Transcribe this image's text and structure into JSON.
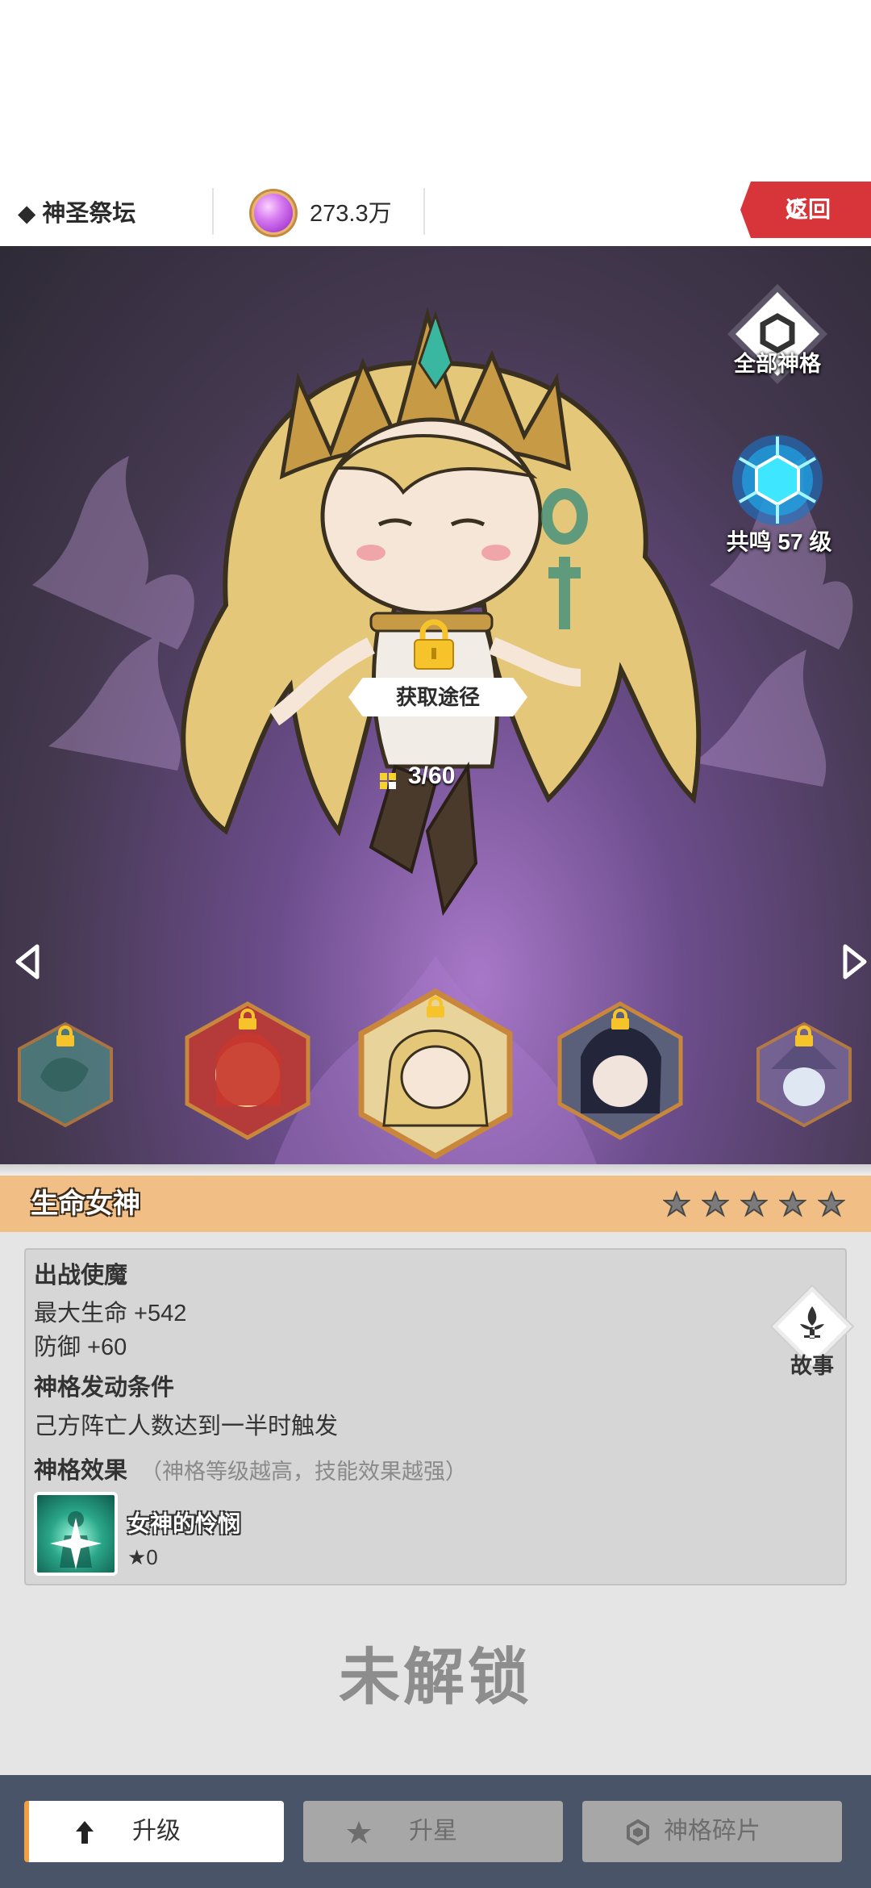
{
  "topbar": {
    "title": "◆ 神圣祭坛",
    "currency_amount": "273.3万",
    "back_label": "返回"
  },
  "stage": {
    "all_gods_label": "全部神格",
    "resonance_label": "共鸣 57 级",
    "acquire_label": "获取途径",
    "fragments": "3/60",
    "portraits": [
      {
        "name": "dragon-god-portrait",
        "locked": true
      },
      {
        "name": "flame-god-portrait",
        "locked": true
      },
      {
        "name": "life-goddess-portrait",
        "locked": true,
        "selected": true
      },
      {
        "name": "dark-goddess-portrait",
        "locked": true
      },
      {
        "name": "ice-mage-portrait",
        "locked": true
      }
    ]
  },
  "god": {
    "name": "生命女神",
    "stars_total": 5,
    "stars_filled": 0
  },
  "details": {
    "battle_title": "出战使魔",
    "stat_hp": "最大生命 +542",
    "stat_def": "防御 +60",
    "trigger_title": "神格发动条件",
    "trigger_text": "己方阵亡人数达到一半时触发",
    "effect_title": "神格效果",
    "effect_hint": "（神格等级越高，技能效果越强）",
    "skill_name": "女神的怜悯",
    "skill_level": "★0",
    "story_label": "故事"
  },
  "status": {
    "unlock_text": "未解锁"
  },
  "bottom": {
    "upgrade_label": "升级",
    "star_up_label": "升星",
    "fragments_label": "神格碎片"
  },
  "colors": {
    "accent_orange": "#f1be86",
    "back_red": "#d8353a",
    "bottom_bar": "#4a5468",
    "resonance_cyan": "#3fe6ff"
  }
}
